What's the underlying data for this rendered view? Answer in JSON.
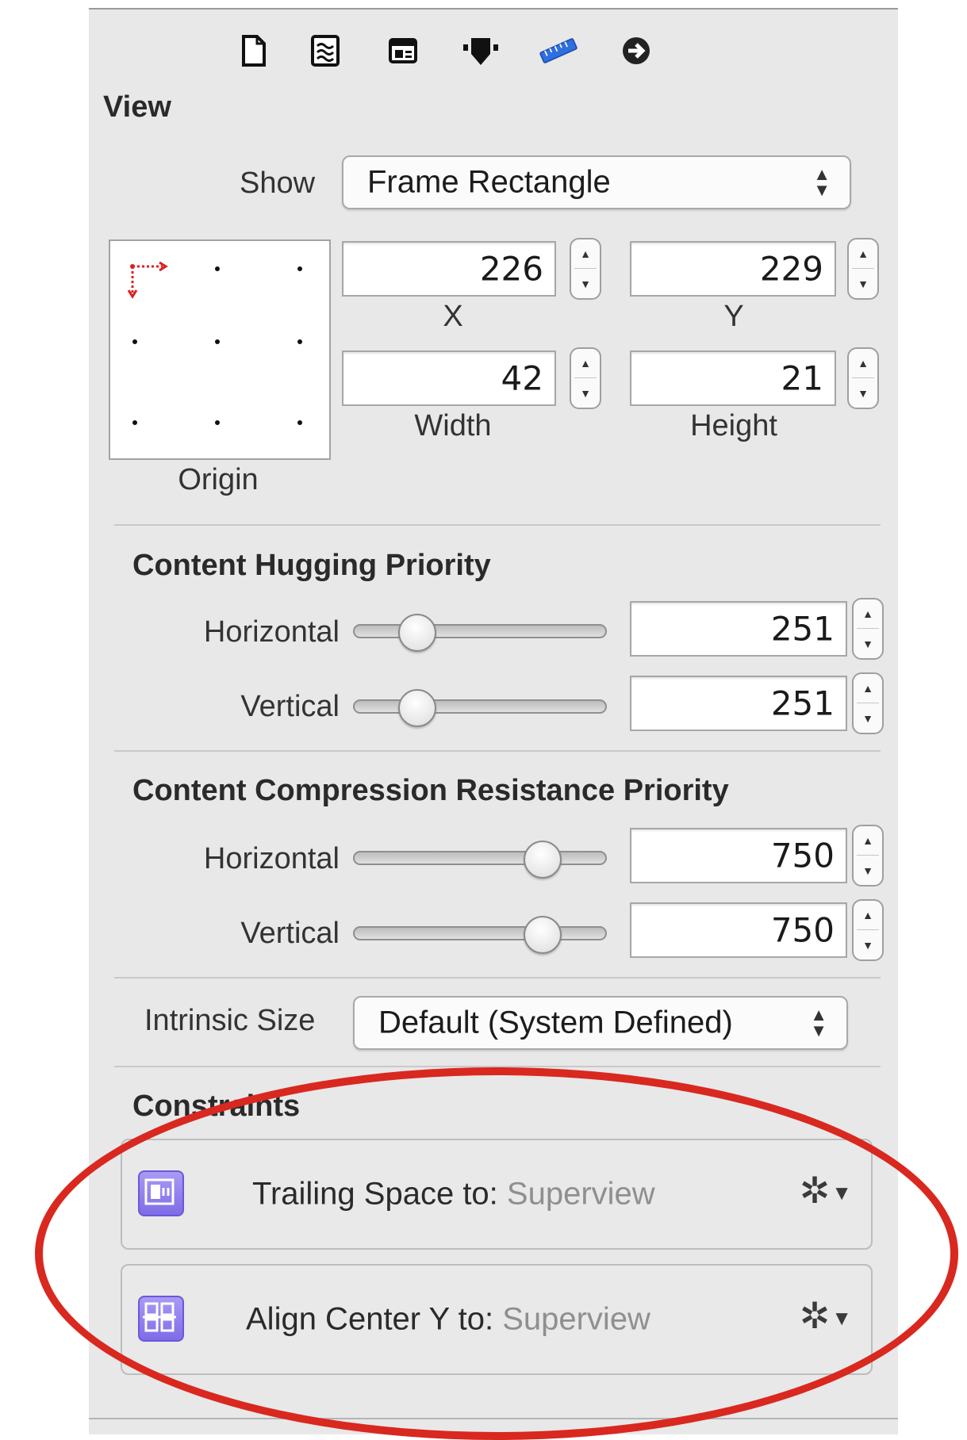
{
  "toolbar": {
    "tabs": [
      {
        "icon": "file-icon"
      },
      {
        "icon": "quick-help-icon"
      },
      {
        "icon": "identity-icon"
      },
      {
        "icon": "attributes-icon"
      },
      {
        "icon": "size-ruler-icon",
        "selected": true
      },
      {
        "icon": "connections-arrow-icon"
      }
    ]
  },
  "view_section": {
    "title": "View",
    "show_label": "Show",
    "show_value": "Frame Rectangle",
    "origin_label": "Origin",
    "x": {
      "value": "226",
      "label": "X"
    },
    "y": {
      "value": "229",
      "label": "Y"
    },
    "width": {
      "value": "42",
      "label": "Width"
    },
    "height": {
      "value": "21",
      "label": "Height"
    }
  },
  "hugging": {
    "title": "Content Hugging Priority",
    "horizontal": {
      "label": "Horizontal",
      "value": "251",
      "level": 0.25
    },
    "vertical": {
      "label": "Vertical",
      "value": "251",
      "level": 0.25
    }
  },
  "compression": {
    "title": "Content Compression Resistance Priority",
    "horizontal": {
      "label": "Horizontal",
      "value": "750",
      "level": 0.75
    },
    "vertical": {
      "label": "Vertical",
      "value": "750",
      "level": 0.75
    }
  },
  "intrinsic": {
    "label": "Intrinsic Size",
    "value": "Default (System Defined)"
  },
  "constraints": {
    "title": "Constraints",
    "items": [
      {
        "label": "Trailing Space to:",
        "target": "Superview",
        "icon": "trailing-space-icon"
      },
      {
        "label": "Align Center Y to:",
        "target": "Superview",
        "icon": "align-center-y-icon"
      }
    ]
  },
  "colors": {
    "accent": "#2f6fe0",
    "highlight": "#d9281f",
    "constraint_icon": "#8e7cf0"
  }
}
